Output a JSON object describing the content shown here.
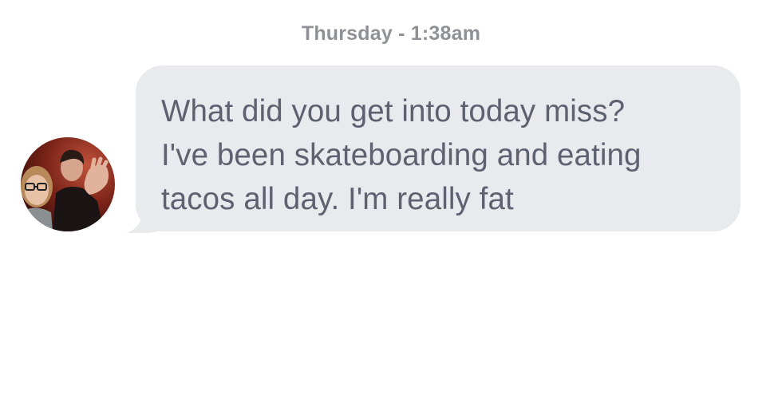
{
  "conversation": {
    "timestamp": "Thursday - 1:38am",
    "messages": [
      {
        "direction": "incoming",
        "avatar_icon": "contact-photo-avatar",
        "text": "What did you get into today miss?\nI've been skateboarding and eating\ntacos all day. I'm really fat"
      }
    ]
  },
  "colors": {
    "bubble_background": "#e9eaee",
    "message_text": "#5d6170",
    "timestamp_text": "#8e9196",
    "page_background": "#ffffff"
  }
}
